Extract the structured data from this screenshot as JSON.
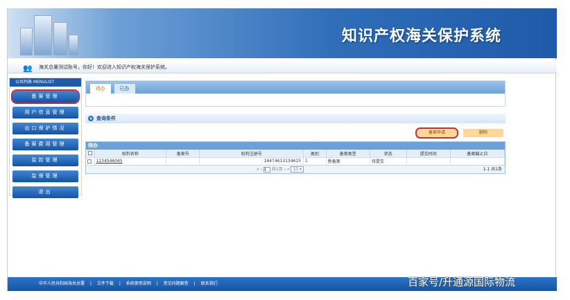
{
  "header": {
    "title": "知识产权海关保护系统"
  },
  "welcome": {
    "text": "海关总署测试账号，你好！欢迎进入知识产权海关保护系统。"
  },
  "sidebar": {
    "head": "公共列表 MENULIST",
    "items": [
      {
        "label": "备案管理"
      },
      {
        "label": "用户信息管理"
      },
      {
        "label": "出口保护情况"
      },
      {
        "label": "备案费用管理"
      },
      {
        "label": "监控管理"
      },
      {
        "label": "监保管理"
      },
      {
        "label": "退出"
      }
    ]
  },
  "tabs": [
    {
      "label": "待办"
    },
    {
      "label": "已办"
    }
  ],
  "query": {
    "label": "查询条件"
  },
  "buttons": {
    "apply": "备案申请",
    "delete": "删除"
  },
  "grid": {
    "title": "待办",
    "columns": [
      "权利名称",
      "备案号",
      "权利注册号",
      "类别",
      "备案类型",
      "状态",
      "提交时间",
      "备案截止日"
    ],
    "rows": [
      [
        "1234546045",
        "",
        "16474613134615",
        "1",
        "新备案",
        "待提交",
        "",
        ""
      ]
    ],
    "pager": {
      "prev": "« ‹",
      "page": "1",
      "of": "共1页",
      "next": "› »",
      "size": "10 ▾",
      "summary": "1-1 共1条"
    }
  },
  "footer": {
    "links": [
      "中华人民共和国海关总署",
      "|",
      "文件下载",
      "|",
      "系统使用说明",
      "|",
      "常见问题解答",
      "|",
      "联系我们"
    ]
  },
  "watermark": "百家号/升通源国际物流"
}
